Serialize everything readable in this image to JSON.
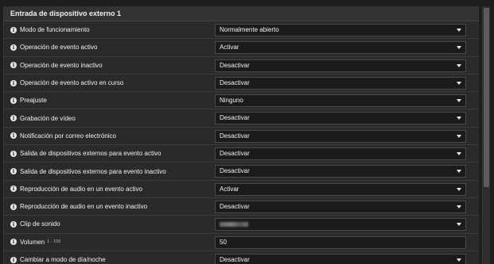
{
  "section": {
    "title": "Entrada de dispositivo externo 1"
  },
  "rows": [
    {
      "label": "Modo de funcionamiento",
      "value": "Normalmente abierto"
    },
    {
      "label": "Operación de evento activo",
      "value": "Activar"
    },
    {
      "label": "Operación de evento inactivo",
      "value": "Desactivar"
    },
    {
      "label": "Operación de evento activo en curso",
      "value": "Desactivar"
    },
    {
      "label": "Preajuste",
      "value": "Ninguno"
    },
    {
      "label": "Grabación de vídeo",
      "value": "Desactivar"
    },
    {
      "label": "Notificación por correo electrónico",
      "value": "Desactivar"
    },
    {
      "label": "Salida de dispositivos externos para evento activo",
      "value": "Desactivar"
    },
    {
      "label": "Salida de dispositivos externos para evento inactivo",
      "value": "Desactivar"
    },
    {
      "label": "Reproducción de audio en un evento activo",
      "value": "Activar"
    },
    {
      "label": "Reproducción de audio en un evento inactivo",
      "value": "Desactivar"
    },
    {
      "label": "Clip de sonido",
      "value": ""
    },
    {
      "label": "Volumen",
      "range_hint": "1 - 100",
      "value": "50"
    },
    {
      "label": "Cambiar a modo de día/noche",
      "value": "Desactivar"
    }
  ],
  "icons": {
    "info": "info-icon",
    "dropdown": "chevron-down-icon"
  },
  "colors": {
    "background": "#1e1e1e",
    "panel": "#2a2a2a",
    "control_bg": "#1b1b1b",
    "text": "#f2f2f2"
  }
}
